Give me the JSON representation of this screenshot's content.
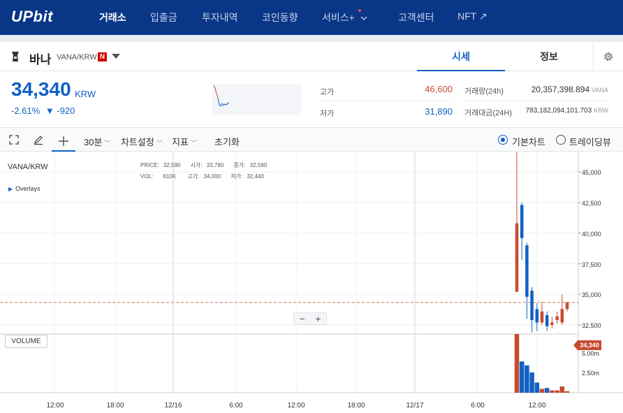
{
  "nav": {
    "logo": "UPbit",
    "items": [
      {
        "label": "거래소",
        "active": true
      },
      {
        "label": "입출금",
        "active": false
      },
      {
        "label": "투자내역",
        "active": false
      },
      {
        "label": "코인동향",
        "active": false
      },
      {
        "label": "서비스+",
        "active": false
      },
      {
        "label": "고객센터",
        "active": false
      },
      {
        "label": "NFT ↗",
        "active": false
      }
    ]
  },
  "coin": {
    "name": "바나",
    "pair": "VANA/KRW",
    "badge": "N",
    "tabs": {
      "sise": "시세",
      "info": "정보"
    },
    "price": "34,340",
    "price_unit": "KRW",
    "change_rate": "-2.61%",
    "change_amount": "▼ -920",
    "high_label": "고가",
    "high_value": "46,600",
    "low_label": "저가",
    "low_value": "31,890",
    "volume_label": "거래량(24h)",
    "volume_value": "20,357,398.894",
    "volume_unit": "VANA",
    "amount_label": "거래대금(24H)",
    "amount_value": "783,182,094,101.703",
    "amount_unit": "KRW"
  },
  "toolbar": {
    "interval": "30분",
    "chart_settings": "차트설정",
    "indicators": "지표",
    "reset": "초기화",
    "basic_chart": "기본차트",
    "tradingview": "트레이딩뷰"
  },
  "chart": {
    "symbol": "VANA/KRW",
    "overlays": "Overlays",
    "legend": {
      "price_label": "PRICE:",
      "price": "32,590",
      "open_label": "시가:",
      "open": "33,780",
      "close_label": "종가:",
      "close": "32,590",
      "vol_label": "VOL:",
      "vol": "610K",
      "high_label": "고가:",
      "high": "34,000",
      "low_label": "저가:",
      "low": "32,440"
    },
    "volume_button": "VOLUME",
    "zoom_minus": "−",
    "zoom_plus": "+",
    "current_price_tag": "34,340",
    "y_ticks": [
      "45,000",
      "42,500",
      "40,000",
      "37,500",
      "35,000",
      "32,500"
    ],
    "vol_ticks": [
      "5.00m",
      "2.50m"
    ],
    "x_ticks": [
      "12:00",
      "18:00",
      "12/16",
      "6:00",
      "12:00",
      "18:00",
      "12/17",
      "6:00",
      "12:00"
    ]
  },
  "chart_data": {
    "type": "candlestick",
    "y_range": [
      30500,
      46500
    ],
    "candles": [
      {
        "open": 35200,
        "close": 40800,
        "high": 46600,
        "low": 35200,
        "dir": "up"
      },
      {
        "open": 42300,
        "close": 39600,
        "high": 42500,
        "low": 37800,
        "dir": "down"
      },
      {
        "open": 39000,
        "close": 34800,
        "high": 39200,
        "low": 33000,
        "dir": "down"
      },
      {
        "open": 35300,
        "close": 32900,
        "high": 35600,
        "low": 31890,
        "dir": "down"
      },
      {
        "open": 33800,
        "close": 32700,
        "high": 34300,
        "low": 32000,
        "dir": "down"
      },
      {
        "open": 32700,
        "close": 33600,
        "high": 34400,
        "low": 32500,
        "dir": "up"
      },
      {
        "open": 33300,
        "close": 32400,
        "high": 33600,
        "low": 32000,
        "dir": "down"
      },
      {
        "open": 32500,
        "close": 32700,
        "high": 33200,
        "low": 32200,
        "dir": "up"
      },
      {
        "open": 32900,
        "close": 33200,
        "high": 33600,
        "low": 32600,
        "dir": "up"
      },
      {
        "open": 32700,
        "close": 33800,
        "high": 35000,
        "low": 32500,
        "dir": "up"
      },
      {
        "open": 33800,
        "close": 34340,
        "high": 34400,
        "low": 33600,
        "dir": "up"
      }
    ],
    "volumes": [
      8.9,
      4.0,
      3.5,
      2.6,
      1.3,
      0.5,
      0.6,
      0.3,
      0.3,
      0.8,
      0.2
    ],
    "volume_unit": "m",
    "current_price": 34340,
    "colors": {
      "up": "#c84a31",
      "down": "#1261c4"
    }
  }
}
